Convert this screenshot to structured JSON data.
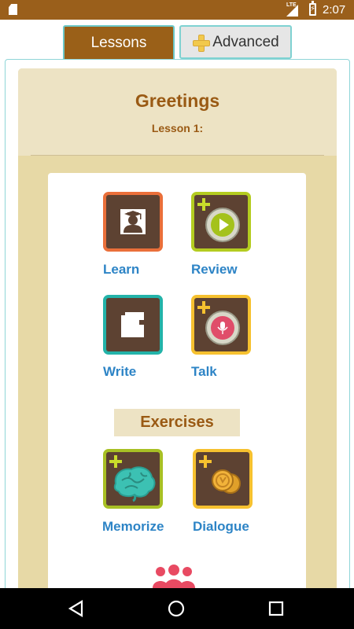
{
  "status_bar": {
    "network": "LTE",
    "time": "2:07",
    "icons": [
      "sd-card-icon",
      "signal-icon",
      "battery-charging-icon"
    ]
  },
  "tabs": [
    {
      "label": "Lessons",
      "selected": true
    },
    {
      "label": "Advanced",
      "selected": false,
      "icon": "plus-icon"
    }
  ],
  "lesson": {
    "title": "Greetings",
    "subtitle": "Lesson 1:"
  },
  "activities": [
    {
      "label": "Learn",
      "icon": "student-graduation-icon",
      "premium": false
    },
    {
      "label": "Review",
      "icon": "play-icon",
      "premium": true
    },
    {
      "label": "Write",
      "icon": "notebook-icon",
      "premium": false
    },
    {
      "label": "Talk",
      "icon": "microphone-icon",
      "premium": true
    }
  ],
  "exercises": {
    "heading": "Exercises",
    "items": [
      {
        "label": "Memorize",
        "icon": "brain-icon",
        "premium": true
      },
      {
        "label": "Dialogue",
        "icon": "coins-dialogue-icon",
        "premium": true
      }
    ]
  },
  "colors": {
    "status_bar": "#9a5f1b",
    "tab_active": "#9a6018",
    "tab_border": "#7fd2d2",
    "title_brown": "#9a5a14",
    "label_blue": "#2d84c6",
    "panel_beige": "#e7d9a6",
    "tile_dark": "#5d4232"
  },
  "nav_bar": {
    "buttons": [
      "back-icon",
      "home-icon",
      "recents-icon"
    ]
  }
}
